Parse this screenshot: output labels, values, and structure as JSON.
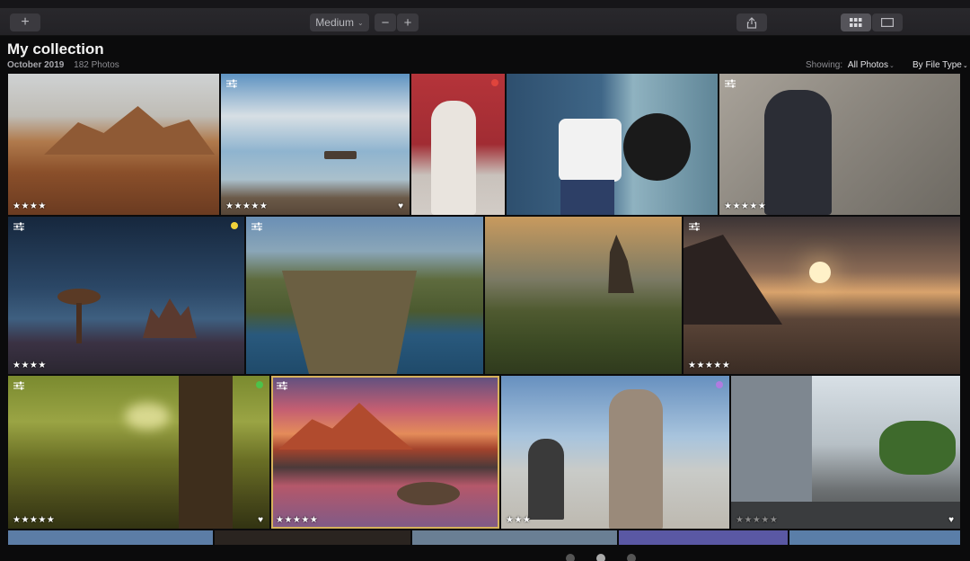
{
  "toolbar": {
    "add_icon": "+",
    "size_label": "Medium",
    "zoom_out_icon": "−",
    "zoom_in_icon": "+"
  },
  "header": {
    "title": "My collection",
    "month": "October 2019",
    "count": "182 Photos",
    "showing_label": "Showing:",
    "showing_value": "All Photos",
    "filetype_label": "By File Type"
  },
  "colors": {
    "selection": "#d6b25c",
    "tag_red": "#e0443c",
    "tag_yellow": "#f2d33a",
    "tag_green": "#4cc24a",
    "tag_purple": "#b07be0"
  },
  "photos": [
    {
      "name": "desert-rocks",
      "stars": "★★★★",
      "adjusted": false,
      "heart": false,
      "tag": null
    },
    {
      "name": "lake-boat",
      "stars": "★★★★★",
      "adjusted": true,
      "heart": true,
      "tag": null
    },
    {
      "name": "woman-red-wall",
      "stars": "",
      "adjusted": false,
      "heart": false,
      "tag": "red"
    },
    {
      "name": "man-jeep",
      "stars": "",
      "adjusted": false,
      "heart": false,
      "tag": null
    },
    {
      "name": "woman-stone-wall",
      "stars": "★★★★★",
      "adjusted": true,
      "heart": false,
      "tag": null
    },
    {
      "name": "milky-way",
      "stars": "★★★★",
      "adjusted": true,
      "heart": false,
      "tag": "yellow"
    },
    {
      "name": "sea-cliffs",
      "stars": "",
      "adjusted": true,
      "heart": false,
      "tag": null
    },
    {
      "name": "rock-sunset",
      "stars": "",
      "adjusted": false,
      "heart": false,
      "tag": null
    },
    {
      "name": "mountain-sun",
      "stars": "★★★★★",
      "adjusted": true,
      "heart": false,
      "tag": null
    },
    {
      "name": "forest-rays",
      "stars": "★★★★★",
      "adjusted": true,
      "heart": true,
      "tag": "green"
    },
    {
      "name": "pink-mountain",
      "stars": "★★★★★",
      "adjusted": true,
      "heart": false,
      "tag": null
    },
    {
      "name": "skateboarders",
      "stars": "★★★",
      "adjusted": false,
      "heart": false,
      "tag": "purple"
    },
    {
      "name": "city-street",
      "stars": "★★★★★",
      "adjusted": false,
      "heart": true,
      "tag": null
    }
  ]
}
